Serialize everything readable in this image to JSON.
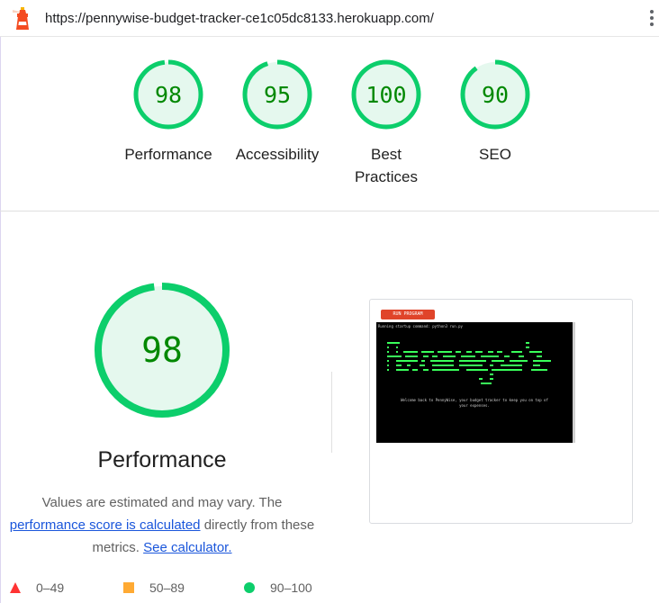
{
  "header": {
    "url": "https://pennywise-budget-tracker-ce1c05dc8133.herokuapp.com/",
    "menu_icon": "kebab-menu-icon",
    "logo_icon": "lighthouse-icon"
  },
  "gauges": [
    {
      "score": "98",
      "label_line1": "Performance",
      "label_line2": "",
      "fraction": 0.98
    },
    {
      "score": "95",
      "label_line1": "Accessibility",
      "label_line2": "",
      "fraction": 0.95
    },
    {
      "score": "100",
      "label_line1": "Best",
      "label_line2": "Practices",
      "fraction": 1.0
    },
    {
      "score": "90",
      "label_line1": "SEO",
      "label_line2": "",
      "fraction": 0.9
    }
  ],
  "performance": {
    "score": "98",
    "fraction": 0.98,
    "title": "Performance",
    "note_pre": "Values are estimated and may vary. The",
    "note_link": "performance score is calculated",
    "note_mid": "directly from these",
    "note_post": "metrics.",
    "calculator_link": "See calculator."
  },
  "legend": [
    {
      "range": "0–49",
      "shape": "triangle",
      "color": "#ff3333"
    },
    {
      "range": "50–89",
      "shape": "square",
      "color": "#ffaa33"
    },
    {
      "range": "90–100",
      "shape": "circle",
      "color": "#0cce6b"
    }
  ],
  "screenshot": {
    "run_button": "RUN PROGRAM",
    "terminal_line": "Running startup command: python3 run.py",
    "welcome_line1": "Welcome back to PennyWise, your budget tracker to keep you on top of",
    "welcome_line2": "your expenses."
  },
  "colors": {
    "pass_green": "#0cce6b",
    "pass_fill": "#e5f8ee",
    "pass_text": "#008800"
  }
}
